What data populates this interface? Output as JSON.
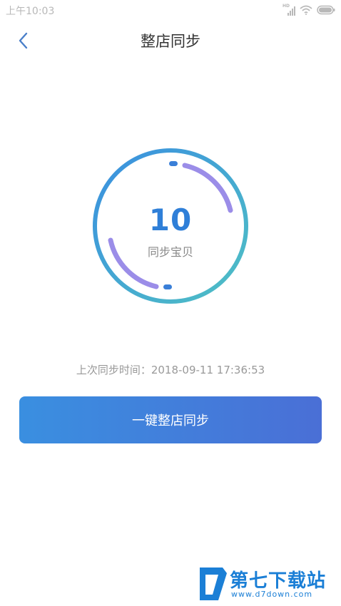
{
  "status_bar": {
    "time": "上午10:03",
    "network_badge": "HD",
    "icons": [
      "signal-icon",
      "wifi-icon",
      "battery-icon"
    ]
  },
  "nav": {
    "back_icon": "chevron-left-icon",
    "title": "整店同步"
  },
  "sync_ring": {
    "count": "10",
    "label": "同步宝贝"
  },
  "last_sync": {
    "text": "上次同步时间：2018-09-11 17:36:53"
  },
  "action": {
    "sync_button_label": "一键整店同步"
  },
  "watermark": {
    "name": "第七下载站",
    "url": "www.d7down.com"
  },
  "colors": {
    "accent_blue": "#2f7fd8",
    "ring_gradient_start": "#3a8fe0",
    "ring_gradient_end": "#4fc0c4",
    "arc_purple": "#9b8de8",
    "button_start": "#3a8fe0",
    "button_end": "#4a6fd6"
  }
}
